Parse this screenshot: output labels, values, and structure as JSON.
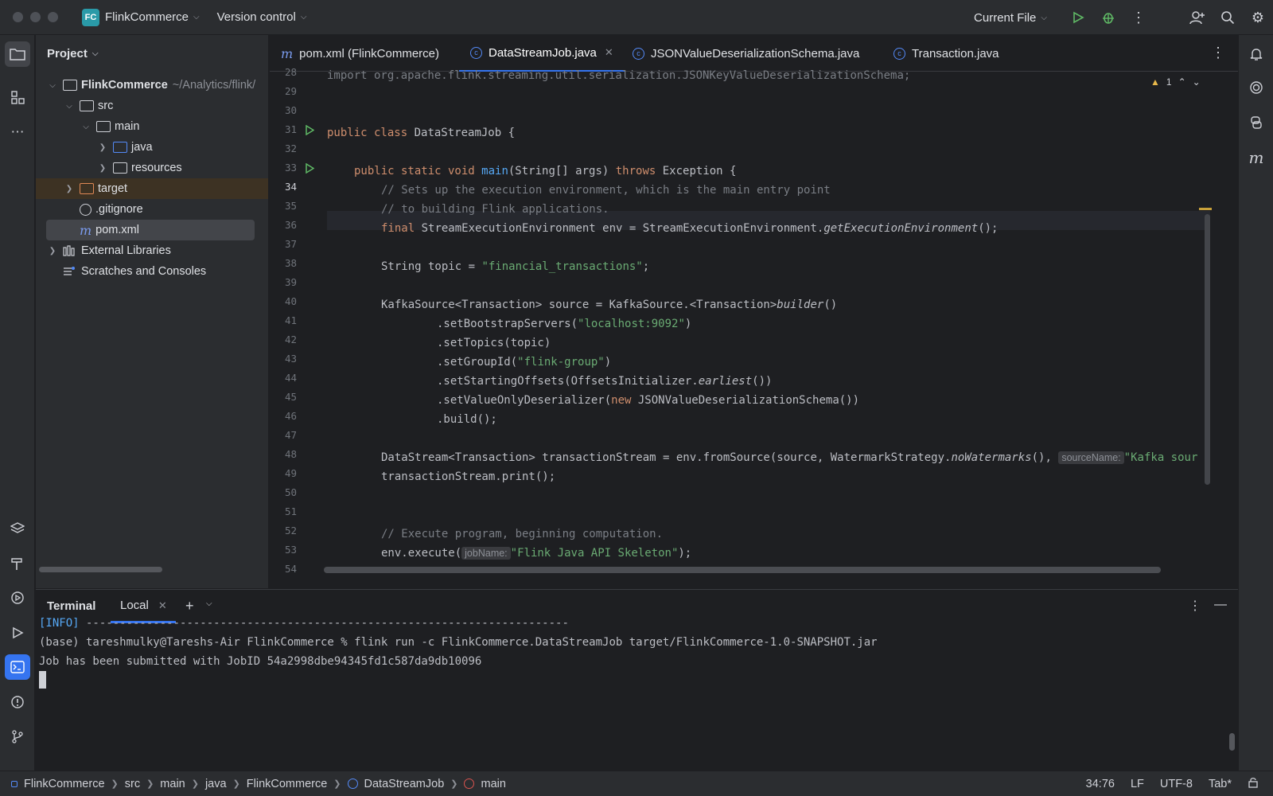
{
  "window": {
    "project_badge": "FC",
    "project_name": "FlinkCommerce",
    "vcs_label": "Version control",
    "run_config": "Current File"
  },
  "icons": {
    "run": "play-icon",
    "debug": "bug-icon",
    "more": "more-vertical-icon",
    "add_user": "add-user-icon",
    "search": "search-icon",
    "settings": "gear-icon"
  },
  "project_panel": {
    "title": "Project",
    "tree": [
      {
        "label": "FlinkCommerce",
        "path": "~/Analytics/flink/"
      },
      {
        "label": "src"
      },
      {
        "label": "main"
      },
      {
        "label": "java"
      },
      {
        "label": "resources"
      },
      {
        "label": "target"
      },
      {
        "label": ".gitignore"
      },
      {
        "label": "pom.xml"
      },
      {
        "label": "External Libraries"
      },
      {
        "label": "Scratches and Consoles"
      }
    ]
  },
  "editor": {
    "tabs": [
      {
        "label": "pom.xml (FlinkCommerce)"
      },
      {
        "label": "DataStreamJob.java"
      },
      {
        "label": "JSONValueDeserializationSchema.java"
      },
      {
        "label": "Transaction.java"
      }
    ],
    "warning_count": "1",
    "line_numbers": [
      "28",
      "29",
      "30",
      "31",
      "32",
      "33",
      "34",
      "35",
      "36",
      "37",
      "38",
      "39",
      "40",
      "41",
      "42",
      "43",
      "44",
      "45",
      "46",
      "47",
      "48",
      "49",
      "50",
      "51",
      "52",
      "53",
      "54"
    ],
    "code": {
      "l28": "import org.apache.flink.streaming.util.serialization.JSONKeyValueDeserializationSchema;",
      "l31_kw": "public class",
      "l31_rest": " DataStreamJob {",
      "l33_kw": "public static void",
      "l33_fn": "main",
      "l33_mid": "(String[] args) ",
      "l33_kw2": "throws",
      "l33_rest": " Exception {",
      "l34": "// Sets up the execution environment, which is the main entry point",
      "l35": "// to building Flink applications.",
      "l36_kw": "final",
      "l36_mid": " StreamExecutionEnvironment env = StreamExecutionEnvironment.",
      "l36_it": "getExecutionEnvironment",
      "l36_end": "();",
      "l38_a": "String topic = ",
      "l38_str": "\"financial_transactions\"",
      "l38_end": ";",
      "l40_a": "KafkaSource<Transaction> source = KafkaSource.<Transaction>",
      "l40_it": "builder",
      "l40_end": "()",
      "l41_a": ".setBootstrapServers(",
      "l41_str": "\"localhost:9092\"",
      "l41_end": ")",
      "l42": ".setTopics(topic)",
      "l43_a": ".setGroupId(",
      "l43_str": "\"flink-group\"",
      "l43_end": ")",
      "l44_a": ".setStartingOffsets(OffsetsInitializer.",
      "l44_it": "earliest",
      "l44_end": "())",
      "l45_a": ".setValueOnlyDeserializer(",
      "l45_kw": "new",
      "l45_end": " JSONValueDeserializationSchema())",
      "l46": ".build();",
      "l48_a": "DataStream<Transaction> transactionStream = env.fromSource(source, WatermarkStrategy.",
      "l48_it": "noWatermarks",
      "l48_b": "(), ",
      "l48_hint": "sourceName:",
      "l48_str": "\"Kafka sour",
      "l49": "transactionStream.print();",
      "l52": "// Execute program, beginning computation.",
      "l53_a": "env.execute(",
      "l53_hint": "jobName:",
      "l53_str": "\"Flink Java API Skeleton\"",
      "l53_end": ");"
    }
  },
  "terminal": {
    "title": "Terminal",
    "tab_label": "Local",
    "lines": {
      "info_tag": "[INFO]",
      "info_rest": " ------------------------------------------------------------------------",
      "cmd": "(base) tareshmulky@Tareshs-Air FlinkCommerce % flink run -c FlinkCommerce.DataStreamJob target/FlinkCommerce-1.0-SNAPSHOT.jar",
      "result": "Job has been submitted with JobID 54a2998dbe94345fd1c587da9db10096"
    }
  },
  "statusbar": {
    "crumbs": [
      "FlinkCommerce",
      "src",
      "main",
      "java",
      "FlinkCommerce",
      "DataStreamJob",
      "main"
    ],
    "position": "34:76",
    "line_sep": "LF",
    "encoding": "UTF-8",
    "indent": "Tab*"
  }
}
